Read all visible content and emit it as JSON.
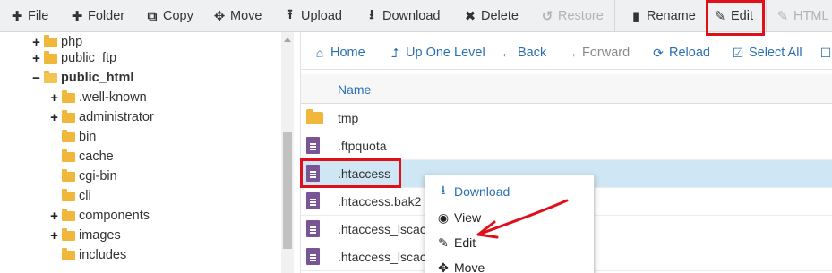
{
  "toolbar": {
    "file": "File",
    "folder": "Folder",
    "copy": "Copy",
    "move": "Move",
    "upload": "Upload",
    "download": "Download",
    "delete": "Delete",
    "restore": "Restore",
    "rename": "Rename",
    "edit": "Edit",
    "html_editor": "HTML E"
  },
  "tree": {
    "items": [
      {
        "label": "php",
        "toggle": "+"
      },
      {
        "label": "public_ftp",
        "toggle": "+"
      },
      {
        "label": "public_html",
        "toggle": "−"
      },
      {
        "label": ".well-known",
        "toggle": "+"
      },
      {
        "label": "administrator",
        "toggle": "+"
      },
      {
        "label": "bin",
        "toggle": ""
      },
      {
        "label": "cache",
        "toggle": ""
      },
      {
        "label": "cgi-bin",
        "toggle": ""
      },
      {
        "label": "cli",
        "toggle": ""
      },
      {
        "label": "components",
        "toggle": "+"
      },
      {
        "label": "images",
        "toggle": "+"
      },
      {
        "label": "includes",
        "toggle": ""
      }
    ]
  },
  "nav": {
    "home": "Home",
    "up_one_level": "Up One Level",
    "back": "Back",
    "forward": "Forward",
    "reload": "Reload",
    "select_all": "Select All"
  },
  "table": {
    "header_name": "Name",
    "rows": [
      {
        "name": "tmp"
      },
      {
        "name": ".ftpquota"
      },
      {
        "name": ".htaccess"
      },
      {
        "name": ".htaccess.bak2"
      },
      {
        "name": ".htaccess_lscac"
      },
      {
        "name": ".htaccess_lscac"
      }
    ]
  },
  "context_menu": {
    "download": "Download",
    "view": "View",
    "edit": "Edit",
    "move": "Move"
  },
  "colors": {
    "accent": "#2a6fb4",
    "highlight": "#e0101b",
    "selected_row": "#cfe6f5",
    "folder": "#f0b73a",
    "document": "#7a5596"
  }
}
